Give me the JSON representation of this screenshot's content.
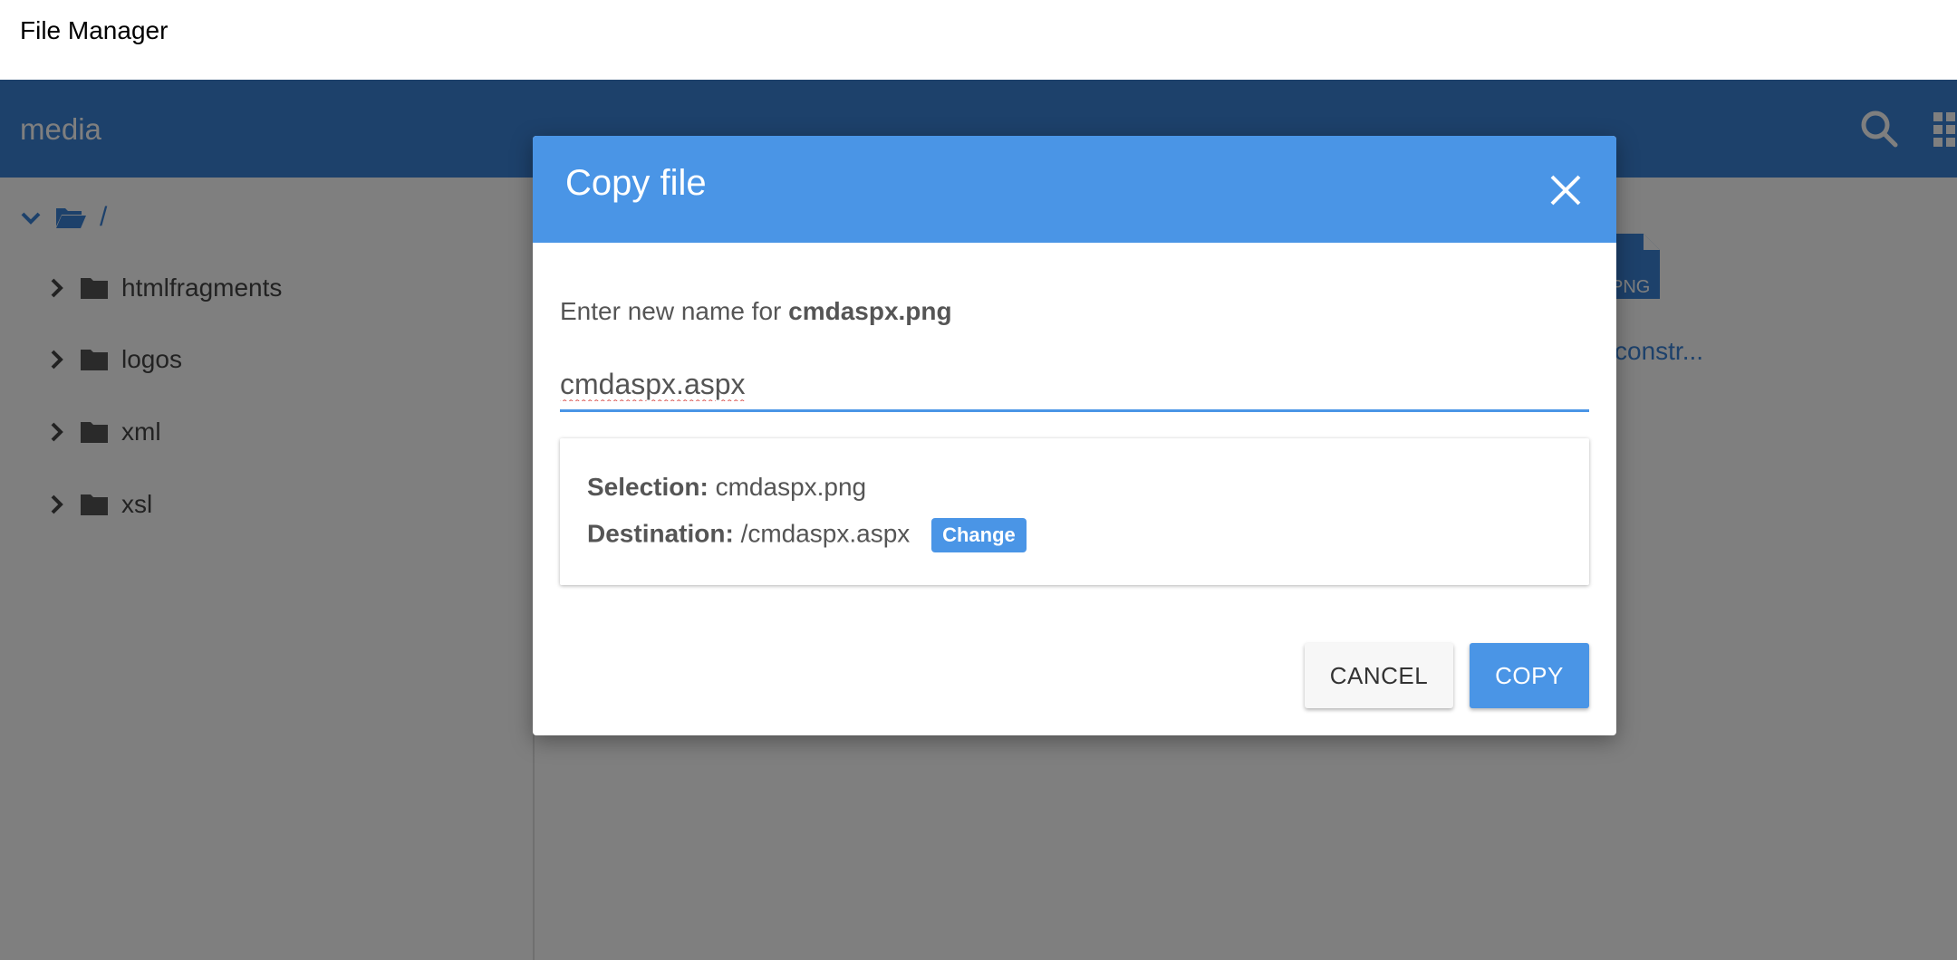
{
  "page": {
    "title": "File Manager"
  },
  "header": {
    "title": "media"
  },
  "tree": {
    "root_label": "/",
    "folders": [
      {
        "label": "htmlfragments"
      },
      {
        "label": "logos"
      },
      {
        "label": "xml"
      },
      {
        "label": "xsl"
      }
    ]
  },
  "content": {
    "file": {
      "ext": "PNG",
      "name": "constr..."
    }
  },
  "dialog": {
    "title": "Copy file",
    "prompt_prefix": "Enter new name for",
    "prompt_filename": "cmdaspx.png",
    "input_value": "cmdaspx.aspx",
    "selection_label": "Selection:",
    "selection_value": "cmdaspx.png",
    "destination_label": "Destination:",
    "destination_value": "/cmdaspx.aspx",
    "change_label": "Change",
    "cancel_label": "CANCEL",
    "copy_label": "COPY"
  },
  "colors": {
    "header": "#3b82d6",
    "dialog_header": "#4a95e6",
    "overlay": "rgba(0,0,0,0.5)"
  },
  "icons": {
    "search": "search-icon",
    "grid": "grid-view-icon",
    "close": "close-icon",
    "folder": "folder-icon",
    "folder_open": "folder-open-icon",
    "chevron_right": "chevron-right-icon",
    "chevron_down": "chevron-down-icon",
    "file": "file-icon"
  }
}
